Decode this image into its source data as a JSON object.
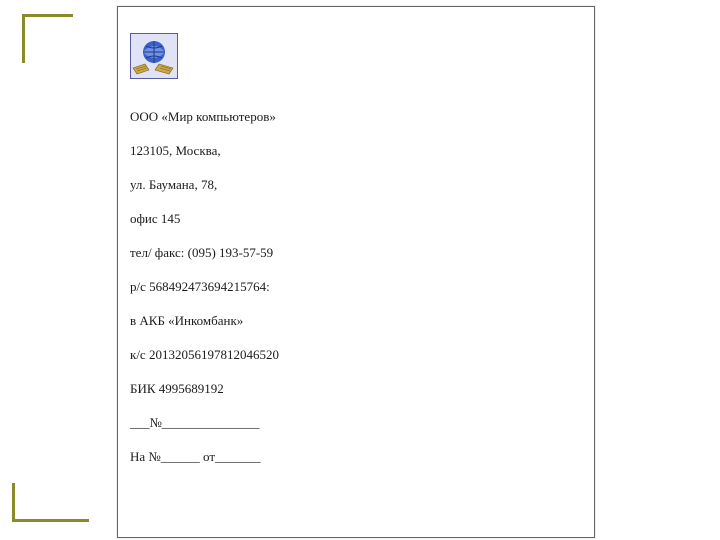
{
  "decor": {
    "accent_color": "#8a8a2a"
  },
  "letterhead": {
    "company": "ООО «Мир компьютеров»",
    "address_line1": "123105, Москва,",
    "address_line2": "ул. Баумана, 78,",
    "address_line3": "офис 145",
    "phone": "тел/ факс: (095) 193-57-59",
    "account": "р/с 568492473694215764:",
    "bank": "в АКБ «Инкомбанк»",
    "corr_account": "к/с 20132056197812046520",
    "bik": "БИК 4995689192",
    "reg_line1": "___№_______________",
    "reg_line2": "На №______ от_______"
  },
  "logo": {
    "name": "computer-globe-logo"
  }
}
